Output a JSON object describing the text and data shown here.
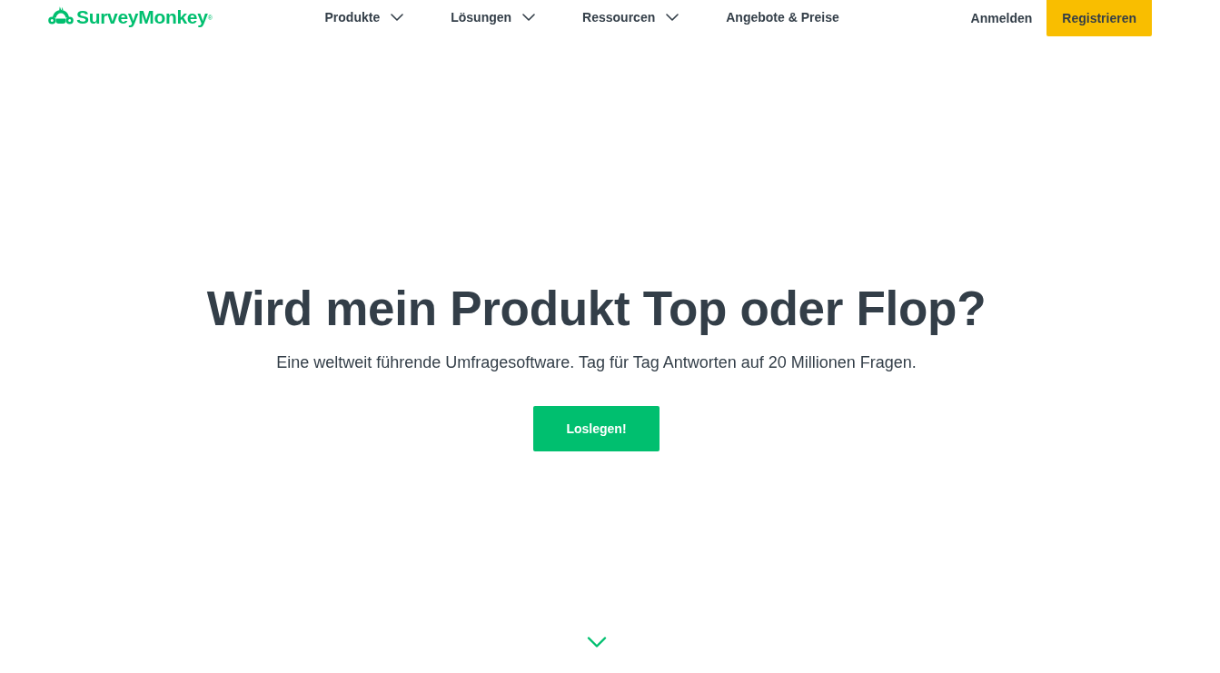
{
  "header": {
    "logo": {
      "name": "SurveyMonkey$^{®}$"
    },
    "nav": [
      {
        "label": "Produkte",
        "has_dropdown": true
      },
      {
        "label": "Lösungen",
        "has_dropdown": true
      },
      {
        "label": "Ressourcen",
        "has_dropdown": true
      },
      {
        "label": "Angebote & Preise",
        "has_dropdown": false
      }
    ],
    "sign_in": "Anmelden",
    "sign_up": "Registrieren"
  },
  "hero": {
    "title": "Wird mein Produkt Top oder Flop?",
    "subtitle": "Eine weltweit führende Umfragesoftware. Tag für Tag Antworten auf 20 Millionen Fragen.",
    "cta": "Loslegen!"
  }
}
